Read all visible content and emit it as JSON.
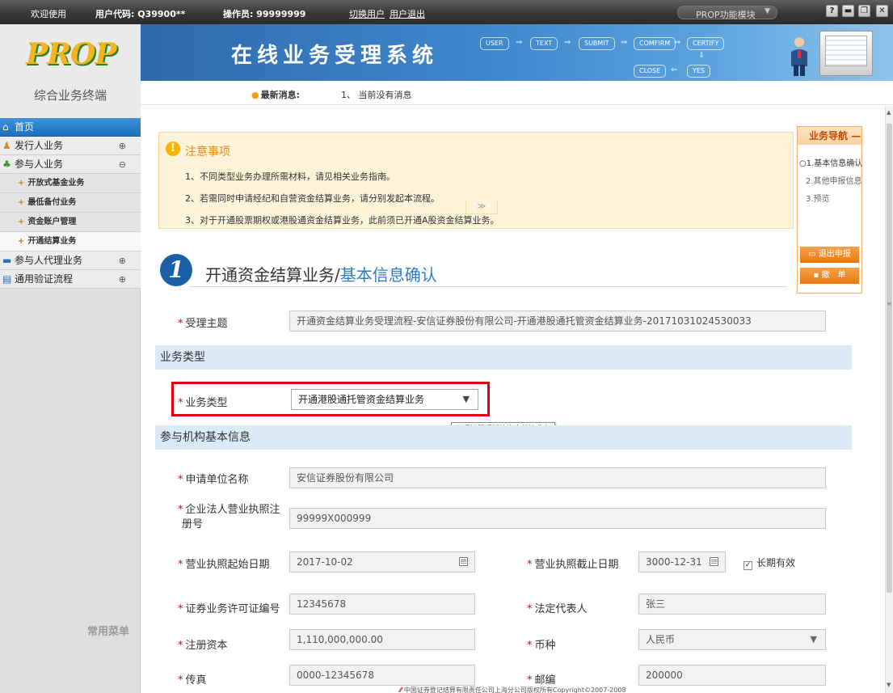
{
  "topbar": {
    "welcome": "欢迎使用",
    "user_code": "用户代码: Q39900**",
    "operator": "操作员: 99999999",
    "switch_user": "切换用户",
    "logout": "用户退出",
    "module_select": "PROP功能模块",
    "window_buttons": [
      "?",
      "▬",
      "❐",
      "✕"
    ]
  },
  "sidebar": {
    "logo_text": "PROP",
    "terminal_title": "综合业务终端",
    "items": [
      {
        "label": "首页",
        "icon": "home-icon"
      },
      {
        "label": "发行人业务",
        "icon": "issuer-icon",
        "toggle": "⊕"
      },
      {
        "label": "参与人业务",
        "icon": "participant-icon",
        "toggle": "⊖"
      },
      {
        "label": "开放式基金业务"
      },
      {
        "label": "最低备付业务"
      },
      {
        "label": "资金账户管理"
      },
      {
        "label": "开通结算业务"
      },
      {
        "label": "参与人代理业务",
        "icon": "agent-icon",
        "toggle": "⊕"
      },
      {
        "label": "通用验证流程",
        "icon": "verify-icon",
        "toggle": "⊕"
      }
    ],
    "favorites_label": "常用菜单"
  },
  "banner": {
    "title": "在线业务受理系统",
    "flow": [
      "USER",
      "TEXT",
      "SUBMIT",
      "COMFIRM",
      "CERTIFY",
      "CLOSE",
      "YES"
    ]
  },
  "news": {
    "label": "最新消息:",
    "text": "1、 当前没有消息"
  },
  "notice": {
    "title": "注意事项",
    "lines": [
      "1、不同类型业务办理所需材料，请见相关业务指南。",
      "2、若需同时申请经纪和自营资金结算业务，请分别发起本流程。",
      "3、对于开通股票期权或港股通资金结算业务，此前须已开通A股资金结算业务。"
    ],
    "toggle": "≫"
  },
  "step": {
    "number": "1",
    "title": "开通资金结算业务/",
    "subtitle": "基本信息确认"
  },
  "form": {
    "subject_label": "受理主题",
    "subject_value": "开通资金结算业务受理流程-安信证券股份有限公司-开通港股通托管资金结算业务-20171031024530033",
    "section_biz_type": "业务类型",
    "biz_type_label": "业务类型",
    "biz_type_value": "开通港股通托管资金结算业务",
    "tooltip": "开通港股通托管资金结算业务",
    "section_org": "参与机构基本信息",
    "org_name_label": "申请单位名称",
    "org_name_value": "安信证券股份有限公司",
    "license_no_label_1": "企业法人营业执照注",
    "license_no_label_2": "册号",
    "license_no_value": "99999X000999",
    "license_start_label": "营业执照起始日期",
    "license_start_value": "2017-10-02",
    "license_end_label": "营业执照截止日期",
    "license_end_value": "3000-12-31",
    "long_valid_label": "长期有效",
    "long_valid_checked": true,
    "permit_label": "证券业务许可证编号",
    "permit_value": "12345678",
    "legal_rep_label": "法定代表人",
    "legal_rep_value": "张三",
    "capital_label": "注册资本",
    "capital_value": "1,110,000,000.00",
    "currency_label": "币种",
    "currency_value": "人民币",
    "fax_label": "传真",
    "fax_value": "0000-12345678",
    "zip_label": "邮编",
    "zip_value": "200000"
  },
  "right_nav": {
    "title": "业务导航",
    "collapse": "—",
    "steps": [
      "○1.基本信息确认",
      "2.其他申报信息",
      "3.预览"
    ],
    "exit_button": "退出申报",
    "cancel_button": "撤　单"
  },
  "footer": {
    "text": "中国证券登记结算有限责任公司上海分公司版权所有Copyright©2007-2008"
  },
  "colors": {
    "accent_blue": "#2f7bc4",
    "required_red": "#e60012",
    "orange": "#e8780f",
    "notice_bg": "#fdf3d8"
  }
}
